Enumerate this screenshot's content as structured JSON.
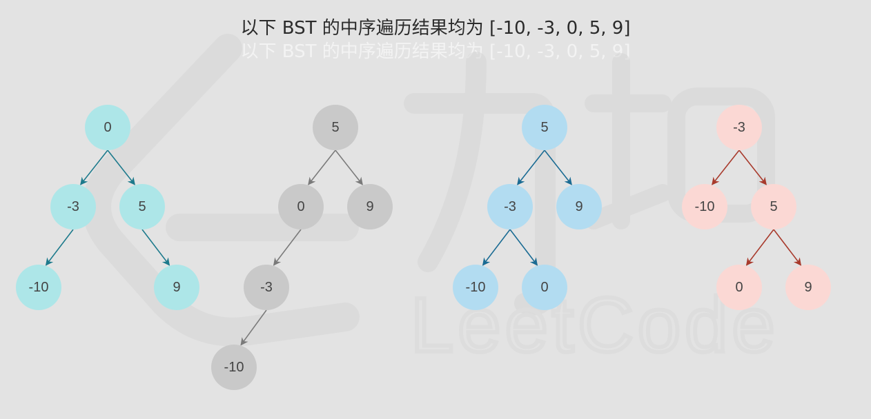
{
  "title": "以下 BST 的中序遍历结果均为 [-10, -3, 0, 5, 9]",
  "watermark": {
    "text": "LeetCode",
    "logo": "力扣"
  },
  "trees": [
    {
      "id": "tree-1",
      "color": "#ade6e8",
      "edge_color": "#1d7a8c",
      "nodes": [
        {
          "id": "n0",
          "label": "0"
        },
        {
          "id": "n1",
          "label": "-3"
        },
        {
          "id": "n2",
          "label": "5"
        },
        {
          "id": "n3",
          "label": "-10"
        },
        {
          "id": "n4",
          "label": "9"
        }
      ],
      "edges": [
        [
          "n0",
          "n1"
        ],
        [
          "n0",
          "n2"
        ],
        [
          "n1",
          "n3"
        ],
        [
          "n2",
          "n4"
        ]
      ]
    },
    {
      "id": "tree-2",
      "color": "#c9c9c9",
      "edge_color": "#7a7a7a",
      "nodes": [
        {
          "id": "n0",
          "label": "5"
        },
        {
          "id": "n1",
          "label": "0"
        },
        {
          "id": "n2",
          "label": "9"
        },
        {
          "id": "n3",
          "label": "-3"
        },
        {
          "id": "n4",
          "label": "-10"
        }
      ],
      "edges": [
        [
          "n0",
          "n1"
        ],
        [
          "n0",
          "n2"
        ],
        [
          "n1",
          "n3"
        ],
        [
          "n3",
          "n4"
        ]
      ]
    },
    {
      "id": "tree-3",
      "color": "#b2dcf1",
      "edge_color": "#1a6b93",
      "nodes": [
        {
          "id": "n0",
          "label": "5"
        },
        {
          "id": "n1",
          "label": "-3"
        },
        {
          "id": "n2",
          "label": "9"
        },
        {
          "id": "n3",
          "label": "-10"
        },
        {
          "id": "n4",
          "label": "0"
        }
      ],
      "edges": [
        [
          "n0",
          "n1"
        ],
        [
          "n0",
          "n2"
        ],
        [
          "n1",
          "n3"
        ],
        [
          "n1",
          "n4"
        ]
      ]
    },
    {
      "id": "tree-4",
      "color": "#fbd8d4",
      "edge_color": "#a83a2c",
      "nodes": [
        {
          "id": "n0",
          "label": "-3"
        },
        {
          "id": "n1",
          "label": "-10"
        },
        {
          "id": "n2",
          "label": "5"
        },
        {
          "id": "n3",
          "label": "0"
        },
        {
          "id": "n4",
          "label": "9"
        }
      ],
      "edges": [
        [
          "n0",
          "n1"
        ],
        [
          "n0",
          "n2"
        ],
        [
          "n2",
          "n3"
        ],
        [
          "n2",
          "n4"
        ]
      ]
    }
  ]
}
